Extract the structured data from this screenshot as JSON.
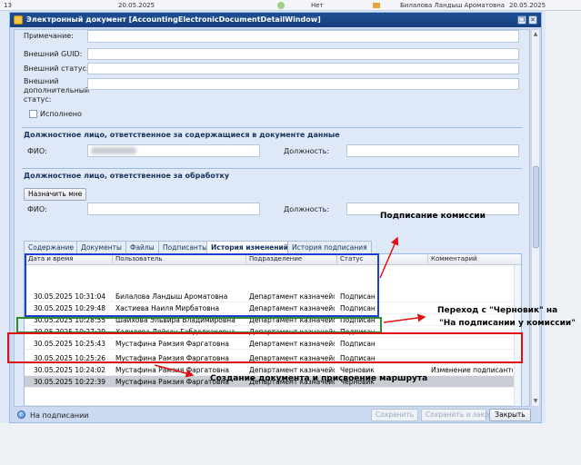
{
  "background_row": {
    "num": "13",
    "date": "20.05.2025",
    "value": "Нет",
    "person": "Билалова Ландыш Ароматовна",
    "date2": "20.05.2025"
  },
  "window": {
    "title": "Электронный документ [AccountingElectronicDocumentDetailWindow]",
    "restore_glyph": "❐",
    "close_glyph": "✕"
  },
  "form": {
    "note_label": "Примечание:",
    "guid_label": "Внешний GUID:",
    "ext_status_label": "Внешний статус:",
    "ext_add_status_label": "Внешний дополнительный статус:",
    "executed_label": "Исполнено"
  },
  "section_data": {
    "title": "Должностное лицо, ответственное за содержащиеся в документе данные",
    "fio_label": "ФИО:",
    "position_label": "Должность:"
  },
  "section_processing": {
    "title": "Должностное лицо, ответственное за обработку",
    "assign_button": "Назначить мне",
    "fio_label": "ФИО:",
    "position_label": "Должность:"
  },
  "tabs": [
    {
      "label": "Содержание"
    },
    {
      "label": "Документы"
    },
    {
      "label": "Файлы"
    },
    {
      "label": "Подписанты"
    },
    {
      "label": "История изменений"
    },
    {
      "label": "История подписания"
    }
  ],
  "grid": {
    "columns": [
      "Дата и время",
      "Пользователь",
      "Подразделение",
      "Статус",
      "Комментарий"
    ],
    "rows": [
      {
        "date": "30.05.2025 10:31:04",
        "user": "Билалова Ландыш Ароматовна",
        "dept": "Департамент казначейства...",
        "status": "Подписан",
        "comment": ""
      },
      {
        "date": "30.05.2025 10:29:48",
        "user": "Хастиева Наиля Мирбатовна",
        "dept": "Департамент казначейства...",
        "status": "Подписан",
        "comment": ""
      },
      {
        "date": "30.05.2025 10:28:55",
        "user": "Шайхова Эльвира Владимировна",
        "dept": "Департамент казначейства...",
        "status": "Подписан",
        "comment": ""
      },
      {
        "date": "30.05.2025 10:27:29",
        "user": "Халилова Ляйсан Габделхаковна",
        "dept": "Департамент казначейства...",
        "status": "Подписан",
        "comment": ""
      },
      {
        "date": "30.05.2025 10:25:43",
        "user": "Мустафина Рамзия Фаргатовна",
        "dept": "Департамент казначейства...",
        "status": "Подписан",
        "comment": ""
      },
      {
        "date": "30.05.2025 10:25:26",
        "user": "Мустафина Рамзия Фаргатовна",
        "dept": "Департамент казначейства...",
        "status": "Подписан",
        "comment": ""
      },
      {
        "date": "30.05.2025 10:24:02",
        "user": "Мустафина Рамзия Фаргатовна",
        "dept": "Департамент казначейства...",
        "status": "Черновик",
        "comment": "Изменение подписантов в..."
      },
      {
        "date": "30.05.2025 10:22:39",
        "user": "Мустафина Рамзия Фаргатовна",
        "dept": "Департамент казначейства...",
        "status": "Черновик",
        "comment": ""
      }
    ]
  },
  "footer": {
    "status": "На подписании",
    "save": "Сохранить",
    "save_close": "Сохранить и закрыть",
    "close": "Закрыть"
  },
  "annotations": {
    "commission": "Подписание комиссии",
    "transition_line1": "Переход с \"Черновик\" на",
    "transition_line2": "\"На подписании у комиссии\"",
    "creation": "Создание документа и присвоение маршрута"
  },
  "colors": {
    "title_bar": "#16407e",
    "blue_box": "#1f3fd1",
    "green_box": "#2e8b2e",
    "red_box": "#e01010"
  }
}
